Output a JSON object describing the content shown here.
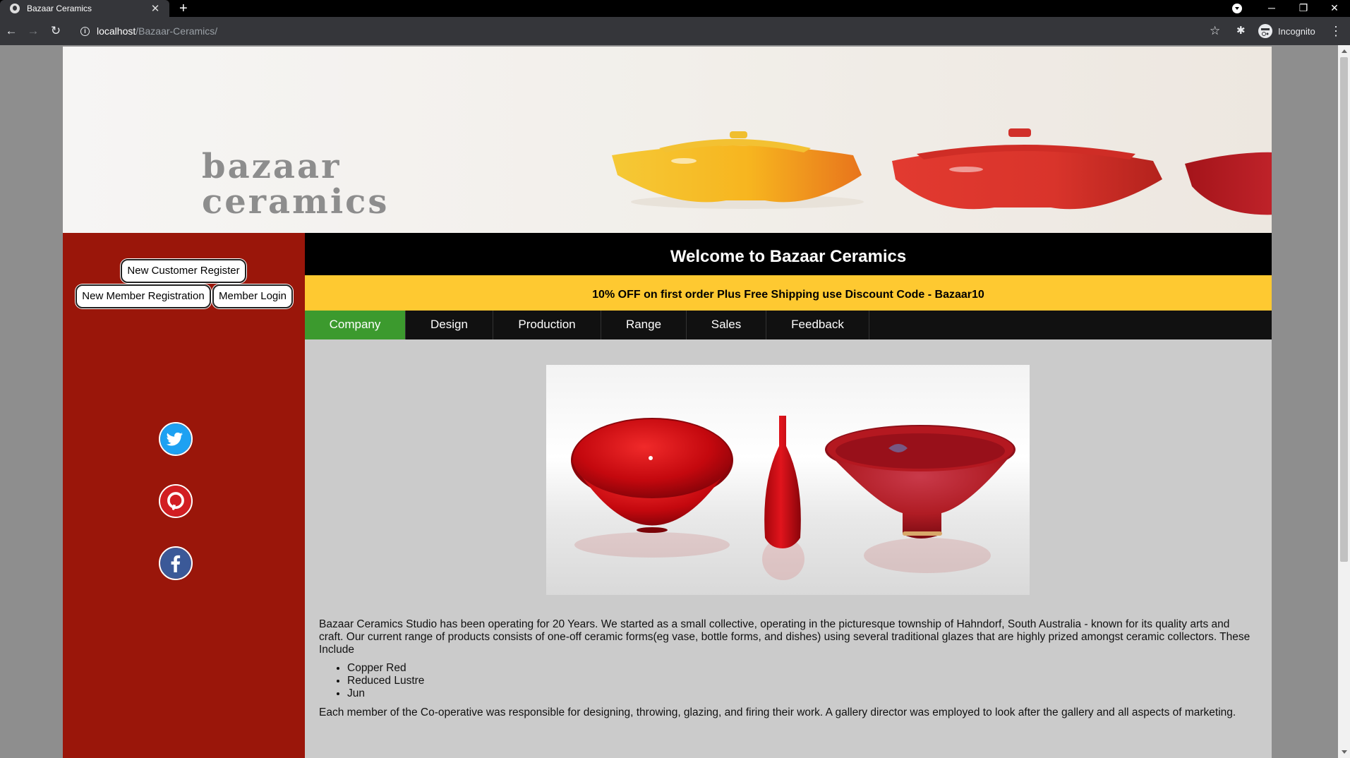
{
  "browser": {
    "tab_title": "Bazaar Ceramics",
    "tab_close": "✕",
    "new_tab": "+",
    "url_host": "localhost",
    "url_path": "/Bazaar-Ceramics/",
    "profile_label": "Incognito",
    "window_controls": {
      "minimize": "─",
      "restore": "❐",
      "close": "✕"
    },
    "nav": {
      "back": "←",
      "forward": "→",
      "reload": "↻",
      "star": "☆",
      "extensions": "✱",
      "menu": "⋮"
    }
  },
  "site": {
    "logo_line1": "bazaar",
    "logo_line2": "ceramics",
    "welcome": "Welcome to Bazaar Ceramics",
    "promo": "10% OFF on first order Plus Free Shipping use Discount Code - Bazaar10"
  },
  "sidebar": {
    "register_button": "New Customer Register",
    "member_registration_button": "New Member Registration",
    "member_login_button": "Member Login",
    "social": [
      {
        "name": "twitter",
        "color": "#1da1f2"
      },
      {
        "name": "pinterest",
        "color": "#d21e22"
      },
      {
        "name": "facebook",
        "color": "#3b5998"
      }
    ]
  },
  "menu": {
    "items": [
      "Company",
      "Design",
      "Production",
      "Range",
      "Sales",
      "Feedback"
    ],
    "active": "Company",
    "active_color": "#3c9a2e"
  },
  "content": {
    "intro": "Bazaar Ceramics Studio has been operating for 20 Years. We started as a small collective, operating in the picturesque township of Hahndorf, South Australia - known for its quality arts and craft. Our current range of products consists of one-off ceramic forms(eg vase, bottle forms, and dishes) using several traditional glazes that are highly prized amongst ceramic collectors. These Include",
    "glazes": [
      "Copper Red",
      "Reduced Lustre",
      "Jun"
    ],
    "outro": "Each member of the Co-operative was responsible for designing, throwing, glazing, and firing their work. A gallery director was employed to look after the gallery and all aspects of marketing."
  },
  "colors": {
    "sidebar": "#9a160a",
    "promo": "#fec931",
    "header": "#000000",
    "page_background": "#cbcbcb"
  }
}
